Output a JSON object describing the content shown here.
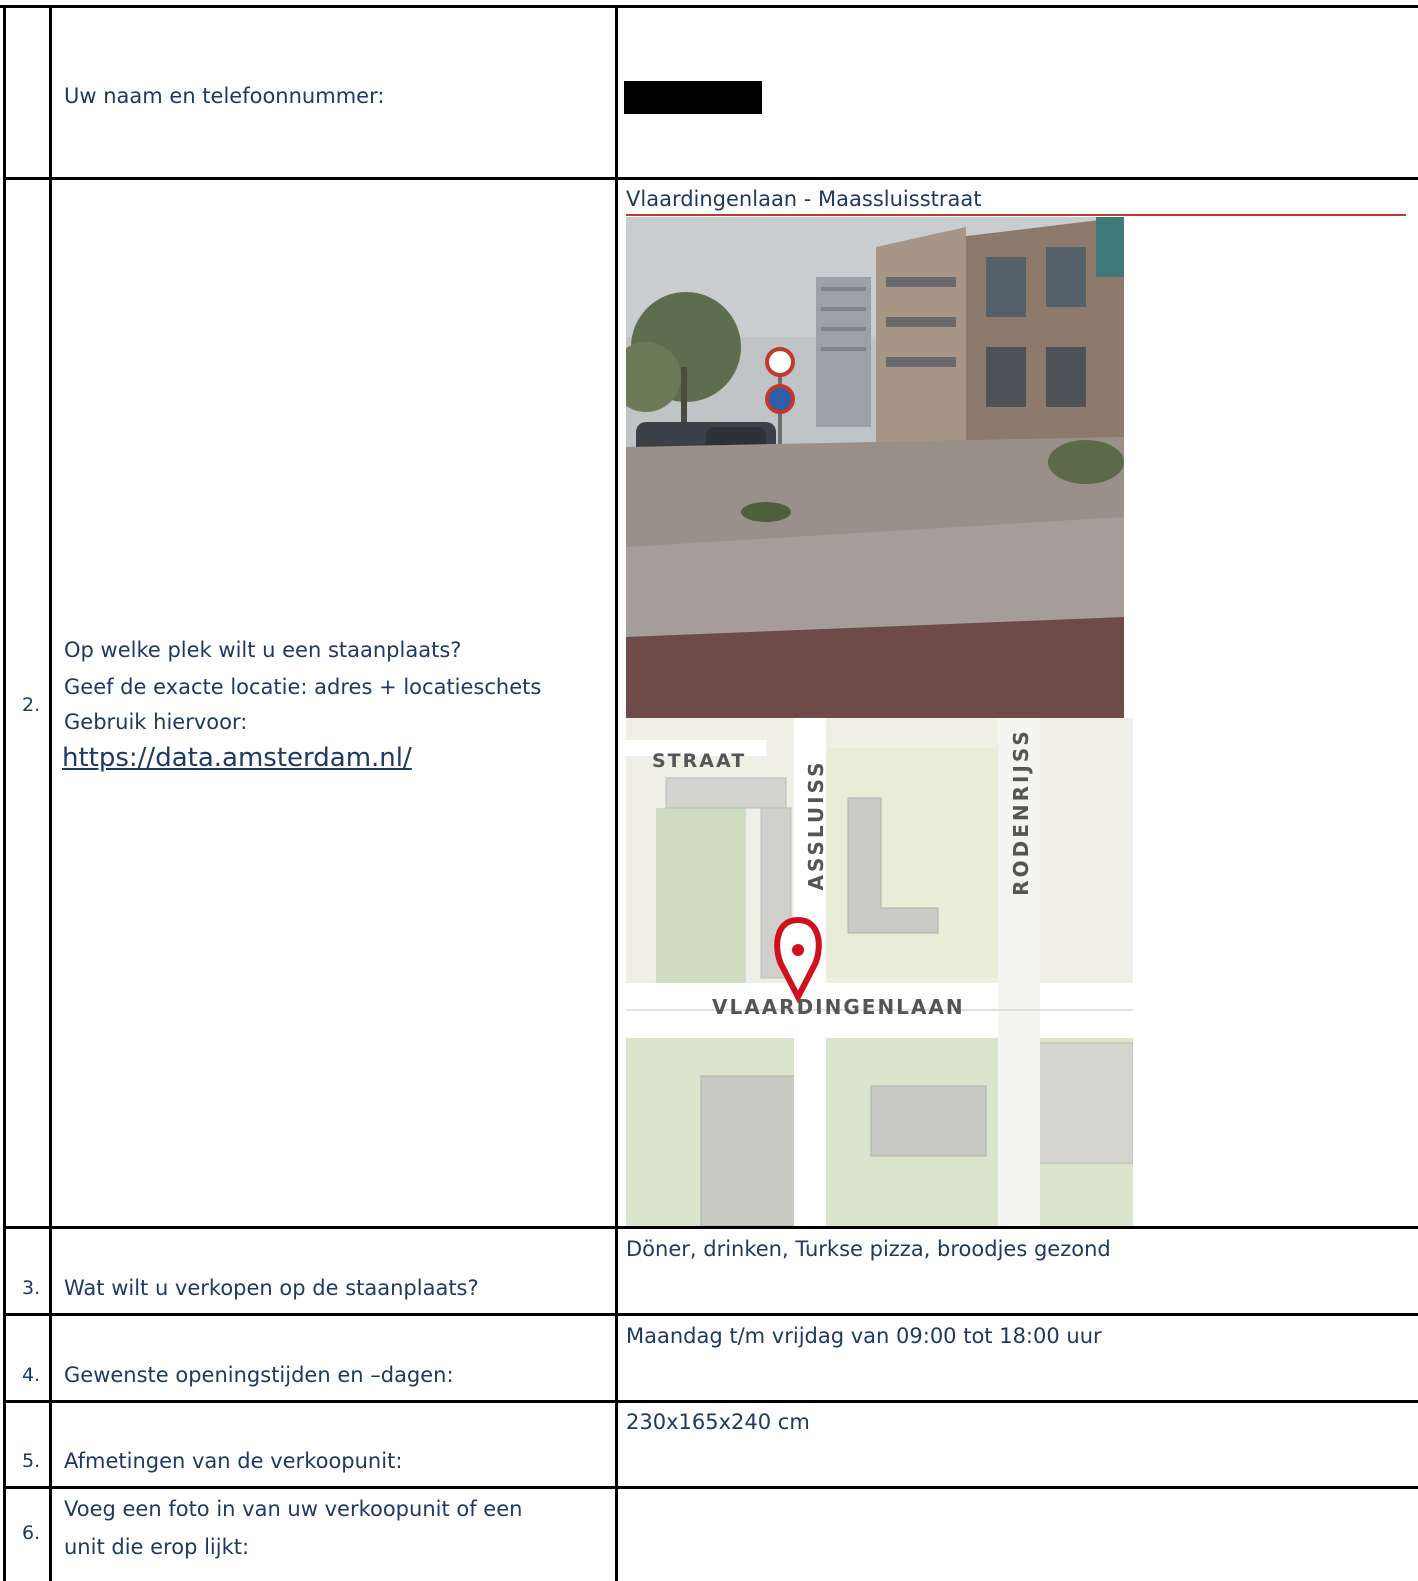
{
  "rows": [
    {
      "number": "",
      "label": "Uw naam en telefoonnummer:",
      "answer": ""
    },
    {
      "number": "2.",
      "label_lines": [
        "Op welke plek wilt u een staanplaats?",
        "Geef de exacte locatie: adres + locatieschets",
        "Gebruik hiervoor:"
      ],
      "link": "https://data.amsterdam.nl/",
      "answer_title": "Vlaardingenlaan - Maassluisstraat"
    },
    {
      "number": "3.",
      "label": "Wat wilt u verkopen op de staanplaats?",
      "answer": "Döner, drinken, Turkse pizza, broodjes gezond"
    },
    {
      "number": "4.",
      "label": "Gewenste openingstijden en –dagen:",
      "answer": "Maandag t/m vrijdag van 09:00 tot 18:00 uur"
    },
    {
      "number": "5.",
      "label": "Afmetingen van de verkoopunit:",
      "answer": "230x165x240 cm"
    },
    {
      "number": "6.",
      "label_lines": [
        "Voeg een foto in van uw verkoopunit of een",
        "unit die erop lijkt:"
      ],
      "answer": ""
    }
  ],
  "map": {
    "labels": {
      "straat": "STRAAT",
      "maassluis": "ASSLUISS",
      "rodenrijs": "RODENRIJSS",
      "vlaardingenlaan": "VLAARDINGENLAAN"
    }
  },
  "colors": {
    "text": "#1f3864",
    "pin": "#d0101a",
    "border": "#000000"
  }
}
